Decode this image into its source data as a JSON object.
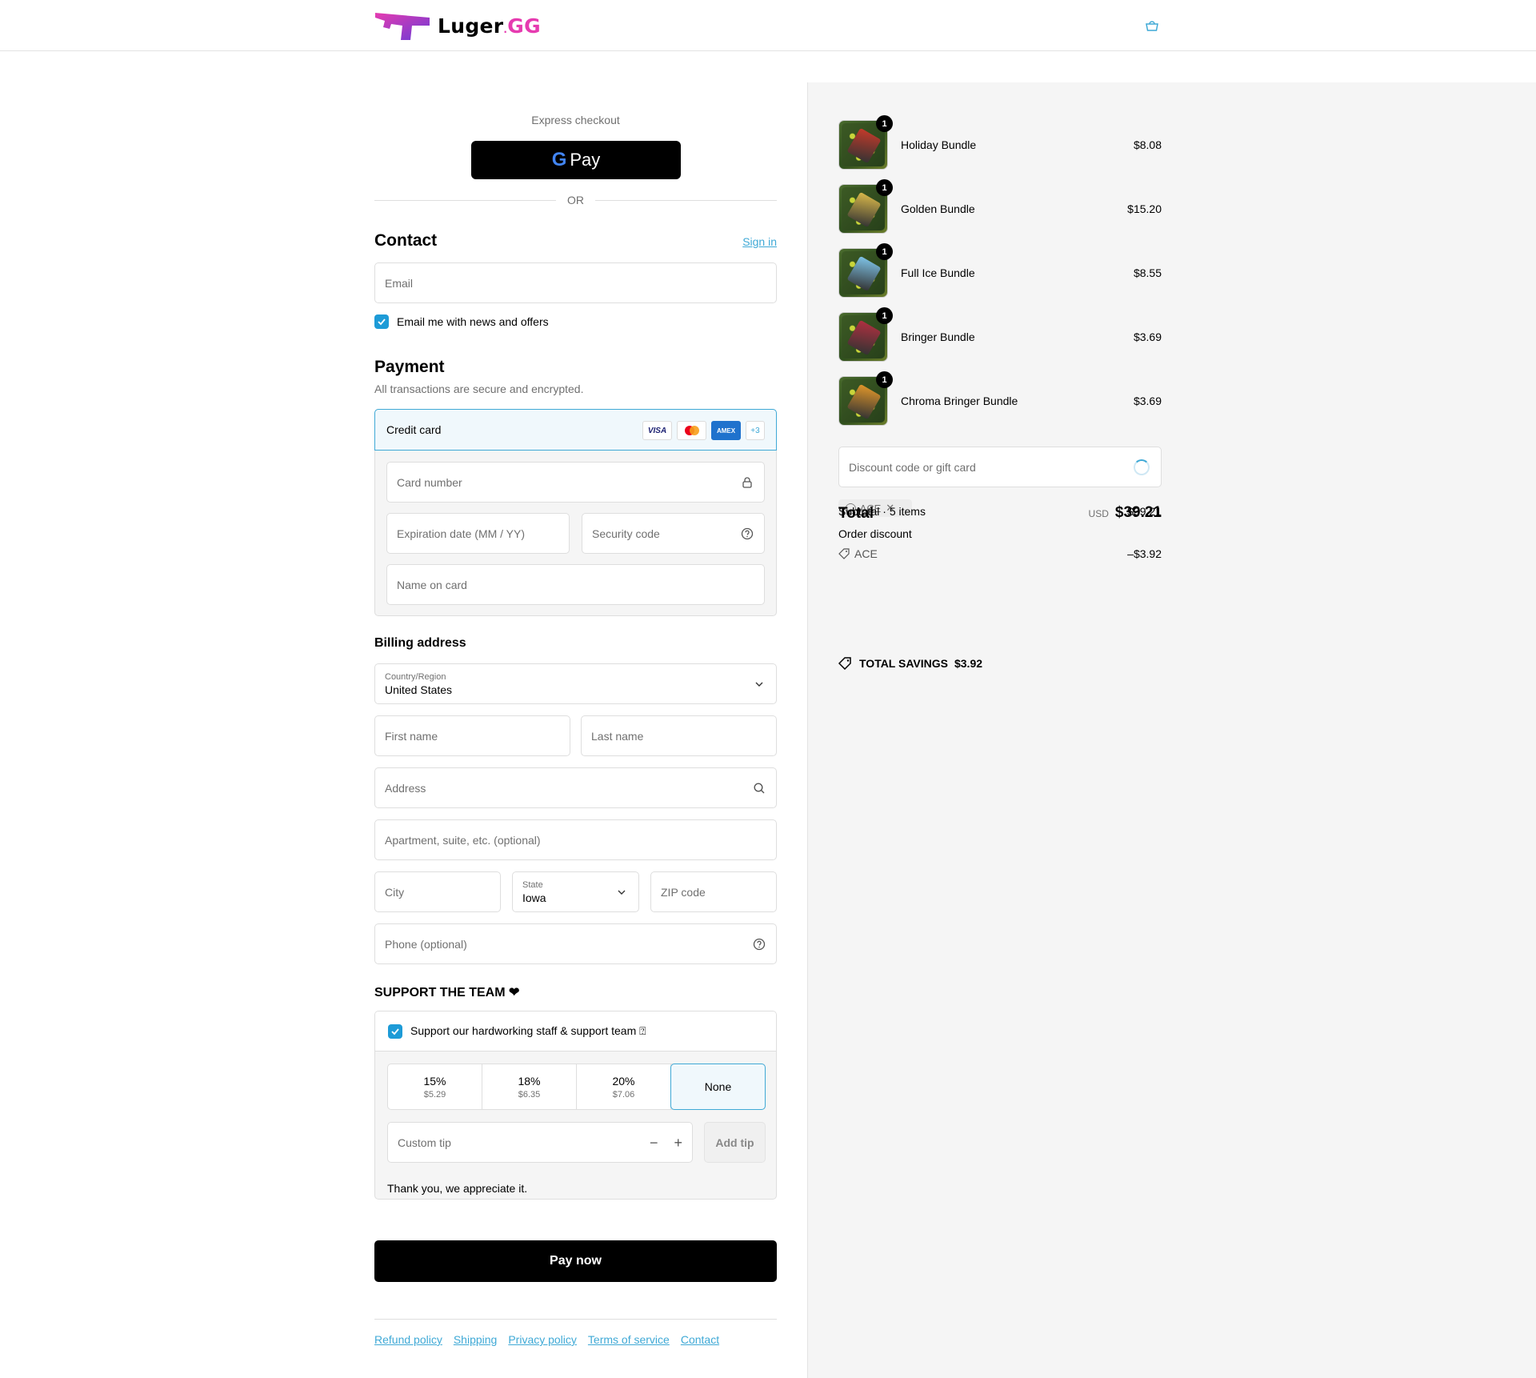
{
  "header": {
    "logo_text_main": "Luger",
    "logo_text_dot": ".",
    "logo_text_gg": "GG"
  },
  "express": {
    "label": "Express checkout",
    "gpay_g": "G",
    "gpay_label": "Pay",
    "or": "OR"
  },
  "contact": {
    "title": "Contact",
    "sign_in": "Sign in",
    "email_placeholder": "Email",
    "newsletter_label": "Email me with news and offers"
  },
  "payment": {
    "title": "Payment",
    "subtitle": "All transactions are secure and encrypted.",
    "method": "Credit card",
    "cards": [
      "VISA",
      "",
      "AMEX",
      "+3"
    ],
    "card_number": "Card number",
    "expiration": "Expiration date (MM / YY)",
    "security_code": "Security code",
    "name_on_card": "Name on card"
  },
  "billing": {
    "title": "Billing address",
    "country_label": "Country/Region",
    "country_value": "United States",
    "first_name": "First name",
    "last_name": "Last name",
    "address": "Address",
    "apartment": "Apartment, suite, etc. (optional)",
    "city": "City",
    "state_label": "State",
    "state_value": "Iowa",
    "zip": "ZIP code",
    "phone": "Phone (optional)"
  },
  "support": {
    "title": "SUPPORT THE TEAM ❤",
    "checkbox_label": "Support our hardworking staff & support team ⍰",
    "options": [
      {
        "pct": "15%",
        "amt": "$5.29"
      },
      {
        "pct": "18%",
        "amt": "$6.35"
      },
      {
        "pct": "20%",
        "amt": "$7.06"
      },
      {
        "pct": "None",
        "amt": ""
      }
    ],
    "custom_tip": "Custom tip",
    "minus": "−",
    "plus": "+",
    "add_tip": "Add tip",
    "thanks": "Thank you, we appreciate it."
  },
  "pay_now": "Pay now",
  "footer_links": [
    "Refund policy",
    "Shipping",
    "Privacy policy",
    "Terms of service",
    "Contact"
  ],
  "order": {
    "items": [
      {
        "name": "Holiday Bundle",
        "price": "$8.08",
        "qty": "1",
        "gun_color": "#c43a2a"
      },
      {
        "name": "Golden Bundle",
        "price": "$15.20",
        "qty": "1",
        "gun_color": "#d9b84a"
      },
      {
        "name": "Full Ice Bundle",
        "price": "$8.55",
        "qty": "1",
        "gun_color": "#7fc4e8"
      },
      {
        "name": "Bringer Bundle",
        "price": "$3.69",
        "qty": "1",
        "gun_color": "#b03040"
      },
      {
        "name": "Chroma Bringer Bundle",
        "price": "$3.69",
        "qty": "1",
        "gun_color": "#e0962a"
      }
    ],
    "discount_placeholder": "Discount code or gift card",
    "chip_code": "ACE",
    "subtotal_label": "Subtotal · 5 items",
    "subtotal_value": "$39.21",
    "order_discount_label": "Order discount",
    "discount_code": "ACE",
    "discount_value": "–$3.92",
    "total_label": "Total",
    "currency": "USD",
    "total_value": "$39.21",
    "savings_label": "TOTAL SAVINGS",
    "savings_value": "$3.92"
  },
  "colors": {
    "accent": "#3fa9d6",
    "checkbox": "#1d9bd7",
    "logo_pink": "#e63bb0"
  }
}
